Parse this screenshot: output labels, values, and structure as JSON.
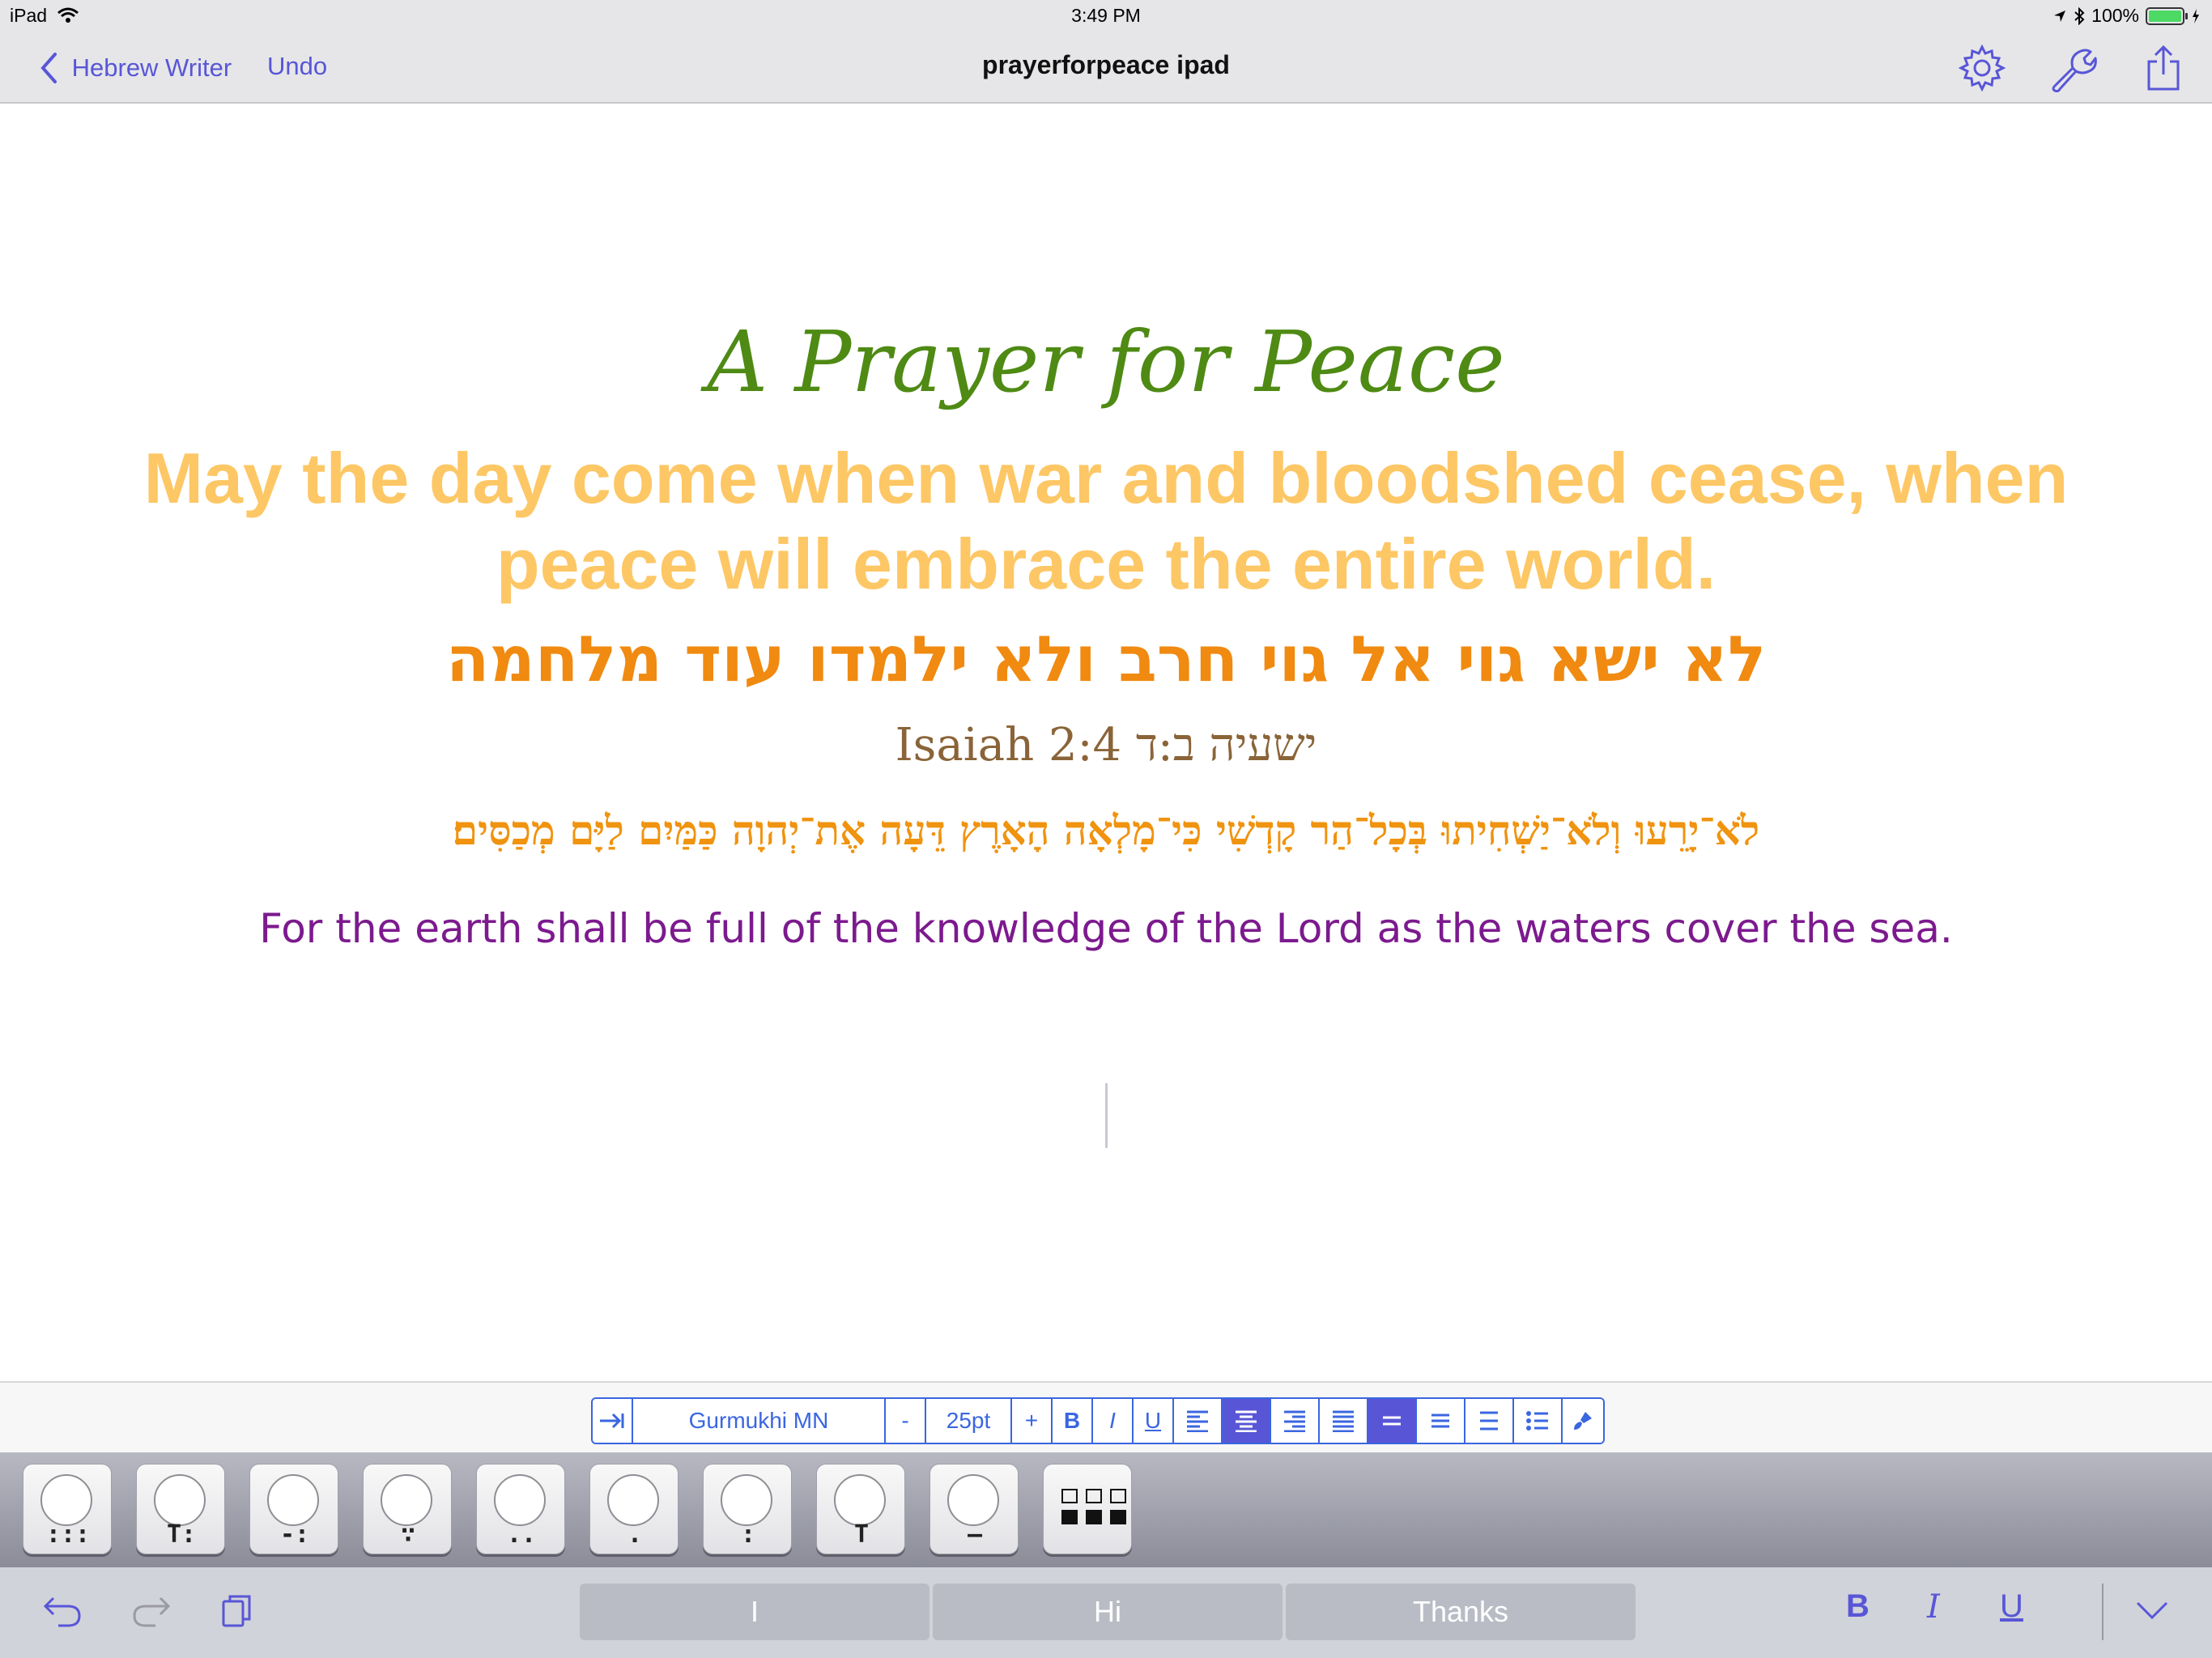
{
  "status_bar": {
    "device": "iPad",
    "time": "3:49 PM",
    "battery": "100%",
    "battery_level": 1.0
  },
  "nav": {
    "back_label": "Hebrew Writer",
    "undo_label": "Undo",
    "title": "prayerforpeace ipad"
  },
  "document": {
    "title": "A Prayer for Peace",
    "english_line1": "May the day come when war and bloodshed cease, when",
    "english_line2": "peace will embrace the entire world.",
    "hebrew_line1": "לא ישא גוי אל גוי חרב ולא ילמדו עוד מלחמה",
    "reference": "Isaiah 2:4 ישעיה ב:ד",
    "hebrew_line2": "לֹא־יָרֵעוּ וְלֹא־יַשְׁחִיתוּ בְּכָל־הַר קָדְשִׁי כִּי־מָלְאָה הָאָרֶץ דֵּעָה אֶת־יְהוָה כַּמַּיִם לַיָּם מְכַסִּים׃",
    "english_line3": "For the earth shall be full of the knowledge of the Lord as the waters cover the sea.",
    "colors": {
      "title": "#4e8a14",
      "english": "#fdc765",
      "hebrew": "#f08a10",
      "reference": "#8a6438",
      "english_purple": "#7c1a8e"
    }
  },
  "format_toolbar": {
    "font_name": "Gurmukhi MN",
    "decrease_label": "-",
    "font_size": "25pt",
    "increase_label": "+",
    "bold_label": "B",
    "italic_label": "I",
    "underline_label": "U",
    "selected_alignment": "center",
    "selected_spacing": "single"
  },
  "vowel_keys": [
    {
      "name": "vowel-key-1",
      "mark": ":::"
    },
    {
      "name": "vowel-key-2",
      "mark": "T:"
    },
    {
      "name": "vowel-key-3",
      "mark": "-:"
    },
    {
      "name": "vowel-key-4",
      "mark": "∵"
    },
    {
      "name": "vowel-key-5",
      "mark": ".."
    },
    {
      "name": "vowel-key-6",
      "mark": "."
    },
    {
      "name": "vowel-key-7",
      "mark": ":"
    },
    {
      "name": "vowel-key-8",
      "mark": "T"
    },
    {
      "name": "vowel-key-9",
      "mark": "—"
    }
  ],
  "shortcut_bar": {
    "suggestions": [
      "I",
      "Hi",
      "Thanks"
    ],
    "bold_label": "B",
    "italic_label": "I",
    "underline_label": "U"
  },
  "accent_color": "#5856d6"
}
